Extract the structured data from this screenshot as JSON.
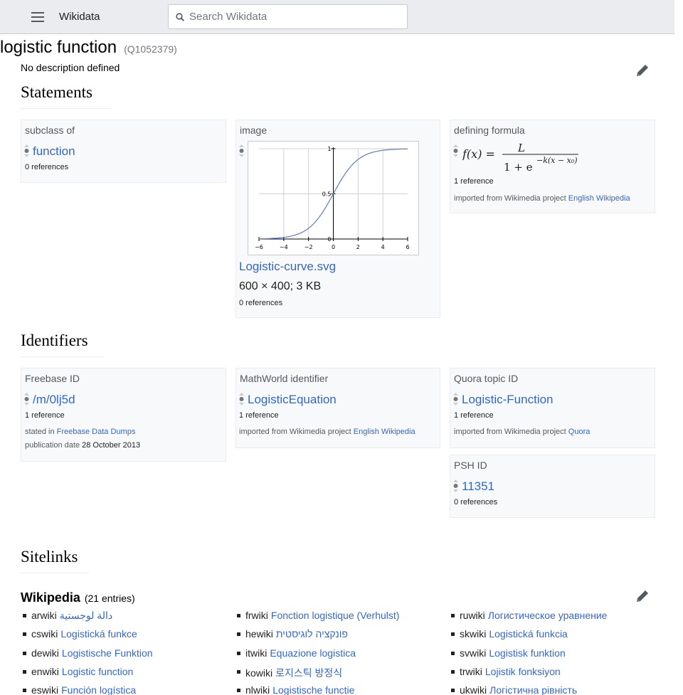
{
  "header": {
    "site_name": "Wikidata",
    "search_placeholder": "Search Wikidata"
  },
  "item": {
    "label": "logistic function",
    "id": "(Q1052379)",
    "description": "No description defined"
  },
  "statements": {
    "heading": "Statements",
    "subclass_of": {
      "property": "subclass of",
      "value": "function",
      "references": "0 references"
    },
    "image": {
      "property": "image",
      "plot": {
        "x_ticks": [
          "−6",
          "−4",
          "−2",
          "0",
          "2",
          "4",
          "6"
        ],
        "y_ticks": [
          "1",
          "0.5",
          "0"
        ]
      },
      "file_name": "Logistic-curve.svg",
      "file_info": "600 × 400; 3 KB",
      "references": "0 references"
    },
    "defining_formula": {
      "property": "defining formula",
      "formula": {
        "lhs": "f(x) =",
        "numerator": "L",
        "denominator": "1 + e",
        "exponent": "−k(x − x₀)"
      },
      "references": "1 reference",
      "source_prefix": "imported from Wikimedia project",
      "source_link": "English Wikipedia"
    }
  },
  "identifiers": {
    "heading": "Identifiers",
    "freebase": {
      "property": "Freebase ID",
      "value": "/m/0lj5d",
      "references": "1 reference",
      "stated_in_label": "stated in",
      "stated_in_value": "Freebase Data Dumps",
      "pubdate_label": "publication date",
      "pubdate_value": "28 October 2013"
    },
    "mathworld": {
      "property": "MathWorld identifier",
      "value": "LogisticEquation",
      "references": "1 reference",
      "source_prefix": "imported from Wikimedia project",
      "source_link": "English Wikipedia"
    },
    "quora": {
      "property": "Quora topic ID",
      "value": "Logistic-Function",
      "references": "1 reference",
      "source_prefix": "imported from Wikimedia project",
      "source_link": "Quora"
    },
    "psh": {
      "property": "PSH ID",
      "value": "11351",
      "references": "0 references"
    }
  },
  "sitelinks": {
    "heading": "Sitelinks",
    "wikipedia_title": "Wikipedia",
    "wikipedia_count": "(21 entries)",
    "columns": [
      [
        {
          "site": "arwiki",
          "title": "دالة لوجستية"
        },
        {
          "site": "cswiki",
          "title": "Logistická funkce"
        },
        {
          "site": "dewiki",
          "title": "Logistische Funktion"
        },
        {
          "site": "enwiki",
          "title": "Logistic function"
        },
        {
          "site": "eswiki",
          "title": "Función logística"
        }
      ],
      [
        {
          "site": "frwiki",
          "title": "Fonction logistique (Verhulst)"
        },
        {
          "site": "hewiki",
          "title": "פונקציה לוגיסטית"
        },
        {
          "site": "itwiki",
          "title": "Equazione logistica"
        },
        {
          "site": "kowiki",
          "title": "로지스틱 방정식"
        },
        {
          "site": "nlwiki",
          "title": "Logistische functie"
        }
      ],
      [
        {
          "site": "ruwiki",
          "title": "Логистическое уравнение"
        },
        {
          "site": "skwiki",
          "title": "Logistická funkcia"
        },
        {
          "site": "svwiki",
          "title": "Logistisk funktion"
        },
        {
          "site": "trwiki",
          "title": "Lojistik fonksiyon"
        },
        {
          "site": "ukwiki",
          "title": "Логістична рівність"
        }
      ]
    ]
  },
  "colors": {
    "link": "#3366cc",
    "card_bg": "#f8f9fa",
    "header_bg": "#eaecf0",
    "curve": "#6b82d6"
  }
}
